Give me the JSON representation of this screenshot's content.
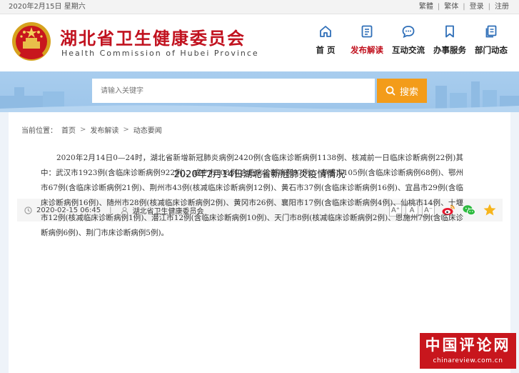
{
  "topbar": {
    "date": "2020年2月15日 星期六",
    "links": [
      "繁體",
      "繁体",
      "登录",
      "注册"
    ]
  },
  "header": {
    "title": "湖北省卫生健康委员会",
    "subtitle": "Health Commission of Hubei Province",
    "nav": [
      {
        "label": "首 页",
        "icon": "home-icon"
      },
      {
        "label": "发布解读",
        "icon": "document-icon"
      },
      {
        "label": "互动交流",
        "icon": "chat-icon"
      },
      {
        "label": "办事服务",
        "icon": "bookmark-icon"
      },
      {
        "label": "部门动态",
        "icon": "pages-icon"
      }
    ],
    "active_nav": "发布解读"
  },
  "search": {
    "placeholder": "请输入关键字",
    "button_label": "搜索"
  },
  "breadcrumb": {
    "prefix": "当前位置：",
    "items": [
      "首页",
      "发布解读",
      "动态要闻"
    ]
  },
  "article": {
    "title": "2020年2月14日湖北省新冠肺炎疫情情况",
    "datetime": "2020-02-15 06:45",
    "separator": "|",
    "source": "湖北省卫生健康委员会",
    "font_buttons": [
      "A⁺",
      "A",
      "A⁻"
    ],
    "body": "2020年2月14日0—24时，湖北省新增新冠肺炎病例2420例(含临床诊断病例1138例、核减前一日临床诊断病例22例)其中：武汉市1923例(含临床诊断病例922例)、咸宁市108例(含临床诊断病例97例)、孝感市105例(含临床诊断病例68例)、鄂州市67例(含临床诊断病例21例)、荆州市43例(核减临床诊断病例12例)、黄石市37例(含临床诊断病例16例)、宜昌市29例(含临床诊断病例16例)、随州市28例(核减临床诊断病例2例)、黄冈市26例、襄阳市17例(含临床诊断病例4例)、仙桃市14例、十堰市12例(核减临床诊断病例1例)、潜江市12例(含临床诊断病例10例)、天门市8例(核减临床诊断病例2例)、恩施州7例(含临床诊断病例6例)、荆门市床诊断病例5例)。"
  },
  "share_icons": [
    "weibo-icon",
    "wechat-icon",
    "favorite-star-icon"
  ],
  "watermark": {
    "main": "中国评论网",
    "url": "chinareview.com.cn"
  },
  "colors": {
    "brand_red": "#c1121f",
    "search_orange": "#f39c1a",
    "banner_blue": "#a8cdee"
  }
}
